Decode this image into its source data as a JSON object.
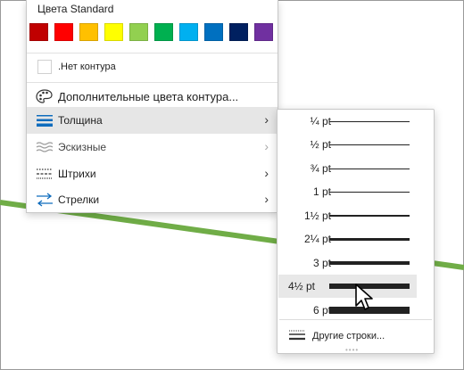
{
  "colors": {
    "accent_line": "#70ad47",
    "standard": [
      "#c00000",
      "#ff0000",
      "#ffc000",
      "#ffff00",
      "#92d050",
      "#00b050",
      "#00b0f0",
      "#0070c0",
      "#002060",
      "#7030a0"
    ]
  },
  "standard_colors": {
    "title": "Цвета Standard"
  },
  "menu": {
    "no_outline": ".Нет контура",
    "more_colors": "Дополнительные цвета контура...",
    "weight": "Толщина",
    "sketched": "Эскизные",
    "dashes": "Штрихи",
    "arrows": "Стрелки"
  },
  "icons": {
    "more_colors": "palette-icon",
    "weight": "line-weight-icon",
    "sketched": "sketch-icon",
    "dashes": "dashes-icon",
    "arrows": "arrows-icon",
    "chevron": "chevron-right-icon"
  },
  "weights": [
    {
      "label": "¼ pt",
      "pt": 0.25
    },
    {
      "label": "½ pt",
      "pt": 0.5
    },
    {
      "label": "¾ pt",
      "pt": 0.75
    },
    {
      "label": "1 pt",
      "pt": 1
    },
    {
      "label": "1½ pt",
      "pt": 1.5
    },
    {
      "label": "2¼ pt",
      "pt": 2.25
    },
    {
      "label": "3 pt",
      "pt": 3
    },
    {
      "label": "4½ pt",
      "pt": 4.5
    },
    {
      "label": "6 pt",
      "pt": 6
    }
  ],
  "selected_weight": "4½ pt",
  "more_lines": "Другие строки...",
  "chevron_glyph": "›"
}
